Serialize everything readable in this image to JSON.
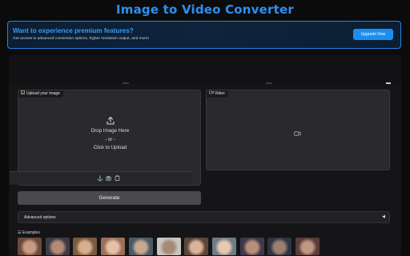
{
  "page": {
    "title": "Image to Video Converter",
    "accent_color": "#2e8ff0"
  },
  "promo": {
    "title": "Want to experience premium features?",
    "description": "Get access to advanced conversion options, higher resolution output, and more!",
    "button_label": "Upgrade Now"
  },
  "upload": {
    "label": "Upload your image",
    "label_icon": "image-icon",
    "upload_icon": "upload-arrow-icon",
    "drop_text": "Drop Image Here",
    "or_text": "- or -",
    "click_text": "Click to Upload",
    "tools": [
      "anchor-icon",
      "camera-icon",
      "clipboard-icon"
    ]
  },
  "video": {
    "label": "Video",
    "label_icon": "video-camera-icon",
    "placeholder_icon": "video-camera-icon"
  },
  "generate": {
    "button_label": "Generate"
  },
  "advanced": {
    "label": "Advanced options",
    "caret": "◀"
  },
  "examples": {
    "label": "Examples",
    "icon": "list-icon",
    "thumbnails": [
      {
        "name": "example-1",
        "colors": [
          "#6b4a3a",
          "#c99a84"
        ]
      },
      {
        "name": "example-2",
        "colors": [
          "#3e3b44",
          "#b48a77"
        ]
      },
      {
        "name": "example-3",
        "colors": [
          "#7a5a40",
          "#d6b08e"
        ]
      },
      {
        "name": "example-4",
        "colors": [
          "#9a7058",
          "#e3c0a6"
        ]
      },
      {
        "name": "example-5",
        "colors": [
          "#4a5a66",
          "#c8a890"
        ]
      },
      {
        "name": "example-6",
        "colors": [
          "#c8c6c0",
          "#a58a78"
        ]
      },
      {
        "name": "example-7",
        "colors": [
          "#5c4638",
          "#d9b49a"
        ]
      },
      {
        "name": "example-8",
        "colors": [
          "#6e7c86",
          "#e8c8b0"
        ]
      },
      {
        "name": "example-9",
        "colors": [
          "#40384a",
          "#b88e78"
        ]
      },
      {
        "name": "example-10",
        "colors": [
          "#2e3442",
          "#9a8070"
        ]
      },
      {
        "name": "example-11",
        "colors": [
          "#5a3c3a",
          "#c09684"
        ]
      }
    ]
  }
}
